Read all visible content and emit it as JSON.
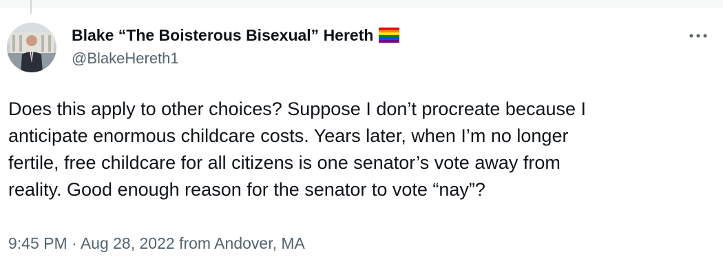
{
  "tweet": {
    "author": {
      "display_name": "Blake “The Boisterous Bisexual” Hereth",
      "handle": "@BlakeHereth1",
      "badge_icon": "rainbow-flag-icon"
    },
    "more_icon": "more-options-icon",
    "text": "Does this apply to other choices? Suppose I don’t procreate because I\nanticipate enormous childcare costs. Years later, when I’m no longer\nfertile, free childcare for all citizens is one senator’s vote away from\nreality. Good enough reason for the senator to vote “nay”?",
    "timestamp": "9:45 PM · Aug 28, 2022",
    "location": "from Andover, MA"
  },
  "colors": {
    "text_primary": "#0f1419",
    "text_secondary": "#536471",
    "thread_line": "#cfd9de",
    "top_strip": "#f7f9f9"
  }
}
